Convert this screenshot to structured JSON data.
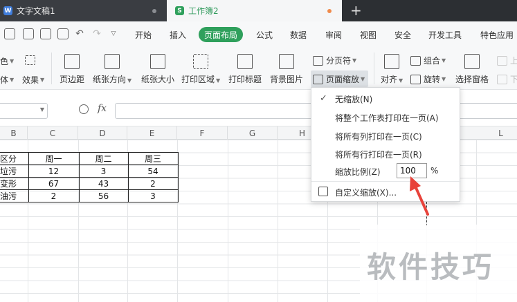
{
  "tabs": [
    {
      "title": "文字文稿1",
      "icon": "W"
    },
    {
      "title": "工作簿2",
      "icon": "S"
    }
  ],
  "new_tab": "+",
  "menu": {
    "items": [
      "开始",
      "插入",
      "页面布局",
      "公式",
      "数据",
      "审阅",
      "视图",
      "安全",
      "开发工具",
      "特色应用"
    ],
    "active": "页面布局"
  },
  "toolbar": {
    "left_partial": {
      "color": "色",
      "font": "体",
      "effect": "效果"
    },
    "margins": "页边距",
    "orientation": "纸张方向",
    "size": "纸张大小",
    "print_area": "打印区域",
    "print_titles": "打印标题",
    "background": "背景图片",
    "page_break": "分页符",
    "page_zoom": "页面缩放",
    "align": "对齐",
    "group": "组合",
    "rotate": "旋转",
    "selection_pane": "选择窗格",
    "up": "上",
    "down": "下"
  },
  "formula_bar": {
    "fx": "fx"
  },
  "columns": [
    "B",
    "C",
    "D",
    "E",
    "F",
    "G",
    "H",
    "L"
  ],
  "table": {
    "header": [
      "区分",
      "周一",
      "周二",
      "周三"
    ],
    "rows": [
      [
        "垃污",
        "12",
        "3",
        "54"
      ],
      [
        "变形",
        "67",
        "43",
        "2"
      ],
      [
        "油污",
        "2",
        "56",
        "3"
      ]
    ]
  },
  "dropdown": {
    "no_zoom": "无缩放(N)",
    "fit_sheet": "将整个工作表打印在一页(A)",
    "fit_columns": "将所有列打印在一页(C)",
    "fit_rows": "将所有行打印在一页(R)",
    "scale_label": "缩放比例(Z)",
    "scale_value": "100",
    "percent": "%",
    "custom": "自定义缩放(X)..."
  },
  "watermark": "软件技巧",
  "colors": {
    "accent": "#2fa05c",
    "arrow": "#e8423a"
  }
}
